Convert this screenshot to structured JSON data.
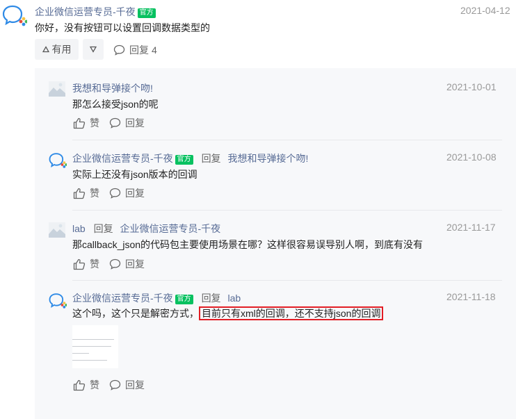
{
  "post": {
    "author": "企业微信运营专员-千夜",
    "badge": "官方",
    "date": "2021-04-12",
    "content": "你好，没有按钮可以设置回调数据类型的",
    "useful_label": "有用",
    "reply_label": "回复",
    "reply_count": "4"
  },
  "replies": [
    {
      "author": "我想和导弹接个吻!",
      "date": "2021-10-01",
      "content": "那怎么接受json的呢",
      "like_label": "赞",
      "reply_label": "回复"
    },
    {
      "author": "企业微信运营专员-千夜",
      "badge": "官方",
      "reply_word": "回复",
      "reply_to": "我想和导弹接个吻!",
      "date": "2021-10-08",
      "content": "实际上还没有json版本的回调",
      "like_label": "赞",
      "reply_label": "回复"
    },
    {
      "author": "lab",
      "reply_word": "回复",
      "reply_to": "企业微信运营专员-千夜",
      "date": "2021-11-17",
      "content": "那callback_json的代码包主要使用场景在哪？这样很容易误导别人啊，到底有没有",
      "like_label": "赞",
      "reply_label": "回复"
    },
    {
      "author": "企业微信运营专员-千夜",
      "badge": "官方",
      "reply_word": "回复",
      "reply_to": "lab",
      "date": "2021-11-18",
      "content_plain": "这个吗，这个只是解密方式，",
      "content_highlight": "目前只有xml的回调，还不支持json的回调",
      "like_label": "赞",
      "reply_label": "回复"
    }
  ],
  "colors": {
    "official_badge": "#07c160",
    "highlight_border": "#e21d24",
    "link": "#576b95"
  }
}
